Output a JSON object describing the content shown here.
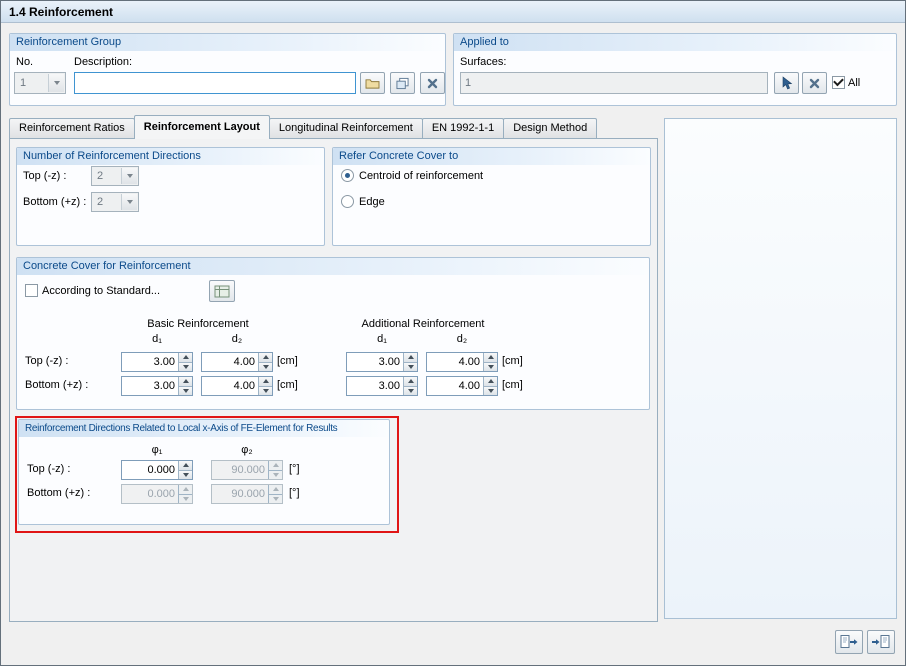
{
  "window": {
    "title": "1.4 Reinforcement"
  },
  "colors": {
    "highlight_rectangle": "#e01515",
    "group_header_text": "#0b4a8a"
  },
  "reinforcement_group": {
    "title": "Reinforcement Group",
    "no_label": "No.",
    "no_value": "1",
    "description_label": "Description:",
    "description_value": "",
    "new_button_icon": "folder-icon",
    "copy_button_icon": "copy-icon",
    "delete_button_icon": "delete-x-icon"
  },
  "applied_to": {
    "title": "Applied to",
    "surfaces_label": "Surfaces:",
    "surfaces_value": "1",
    "pick_button_icon": "pick-cursor-icon",
    "delete_button_icon": "delete-x-icon",
    "all_checkbox_label": "All",
    "all_checked": true
  },
  "tabs": [
    {
      "label": "Reinforcement Ratios",
      "active": false
    },
    {
      "label": "Reinforcement Layout",
      "active": true
    },
    {
      "label": "Longitudinal Reinforcement",
      "active": false
    },
    {
      "label": "EN 1992-1-1",
      "active": false
    },
    {
      "label": "Design Method",
      "active": false
    }
  ],
  "number_of_directions": {
    "title": "Number of Reinforcement Directions",
    "top_label": "Top (-z) :",
    "top_value": "2",
    "bottom_label": "Bottom (+z) :",
    "bottom_value": "2"
  },
  "refer_cover": {
    "title": "Refer Concrete Cover to",
    "option_centroid": "Centroid of reinforcement",
    "option_edge": "Edge",
    "selected": "Centroid of reinforcement"
  },
  "concrete_cover": {
    "title": "Concrete Cover for Reinforcement",
    "standard_checkbox": "According to Standard...",
    "standard_checked": false,
    "standard_button_icon": "standard-settings-icon",
    "basic_header": "Basic Reinforcement",
    "additional_header": "Additional Reinforcement",
    "col_d1": "d₁",
    "col_d2": "d₂",
    "unit": "[cm]",
    "row_top_label": "Top (-z) :",
    "row_bottom_label": "Bottom (+z) :",
    "values": {
      "top": [
        "3.00",
        "4.00",
        "3.00",
        "4.00"
      ],
      "bottom": [
        "3.00",
        "4.00",
        "3.00",
        "4.00"
      ]
    }
  },
  "result_directions": {
    "title": "Reinforcement Directions Related to Local x-Axis of FE-Element for Results",
    "col_phi1": "φ₁",
    "col_phi2": "φ₂",
    "unit": "[°]",
    "row_top_label": "Top (-z) :",
    "row_bottom_label": "Bottom (+z) :",
    "values": {
      "top": [
        "0.000",
        "90.000"
      ],
      "bottom": [
        "0.000",
        "90.000"
      ]
    },
    "enabled": {
      "top": [
        true,
        false
      ],
      "bottom": [
        false,
        false
      ]
    }
  },
  "bottom_buttons": {
    "save_defaults_icon": "save-defaults-icon",
    "restore_defaults_icon": "restore-defaults-icon"
  }
}
